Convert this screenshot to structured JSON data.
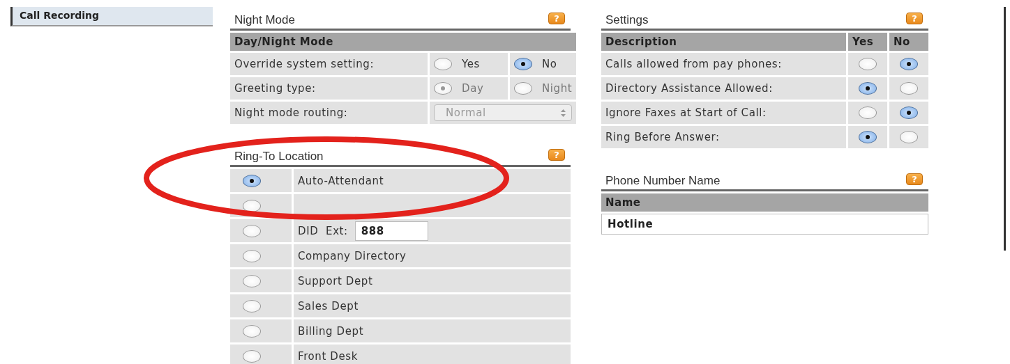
{
  "sidebar": {
    "items": [
      {
        "label": "Call Recording",
        "selected": true
      }
    ]
  },
  "night_mode": {
    "title": "Night Mode",
    "help": "?",
    "header": "Day/Night Mode",
    "rows": [
      {
        "kind": "radio",
        "label": "Override system setting:",
        "disabled": false,
        "options": [
          {
            "label": "Yes",
            "selected": false
          },
          {
            "label": "No",
            "selected": true
          }
        ]
      },
      {
        "kind": "radio",
        "label": "Greeting type:",
        "disabled": true,
        "options": [
          {
            "label": "Day",
            "selected": true
          },
          {
            "label": "Night",
            "selected": false
          }
        ]
      },
      {
        "kind": "select",
        "label": "Night mode routing:",
        "disabled": true,
        "value": "Normal"
      }
    ]
  },
  "ring_to_location": {
    "title": "Ring-To Location",
    "help": "?",
    "options": [
      {
        "kind": "plain",
        "label": "Auto-Attendant",
        "selected": true
      },
      {
        "kind": "covered",
        "selected": false
      },
      {
        "kind": "extension",
        "label": "DID  Ext:",
        "value": "888",
        "selected": false
      },
      {
        "kind": "plain",
        "label": "Company Directory",
        "selected": false
      },
      {
        "kind": "plain",
        "label": "Support Dept",
        "selected": false
      },
      {
        "kind": "plain",
        "label": "Sales Dept",
        "selected": false
      },
      {
        "kind": "plain",
        "label": "Billing Dept",
        "selected": false
      },
      {
        "kind": "plain",
        "label": "Front Desk",
        "selected": false
      }
    ]
  },
  "settings": {
    "title": "Settings",
    "help": "?",
    "columns": [
      "Description",
      "Yes",
      "No"
    ],
    "rows": [
      {
        "label": "Calls allowed from pay phones:",
        "yes": false,
        "no": true
      },
      {
        "label": "Directory Assistance Allowed:",
        "yes": true,
        "no": false
      },
      {
        "label": "Ignore Faxes at Start of Call:",
        "yes": false,
        "no": true
      },
      {
        "label": "Ring Before Answer:",
        "yes": true,
        "no": false
      }
    ]
  },
  "phone_number_name": {
    "title": "Phone Number Name",
    "help": "?",
    "header": "Name",
    "value": "Hotline"
  }
}
